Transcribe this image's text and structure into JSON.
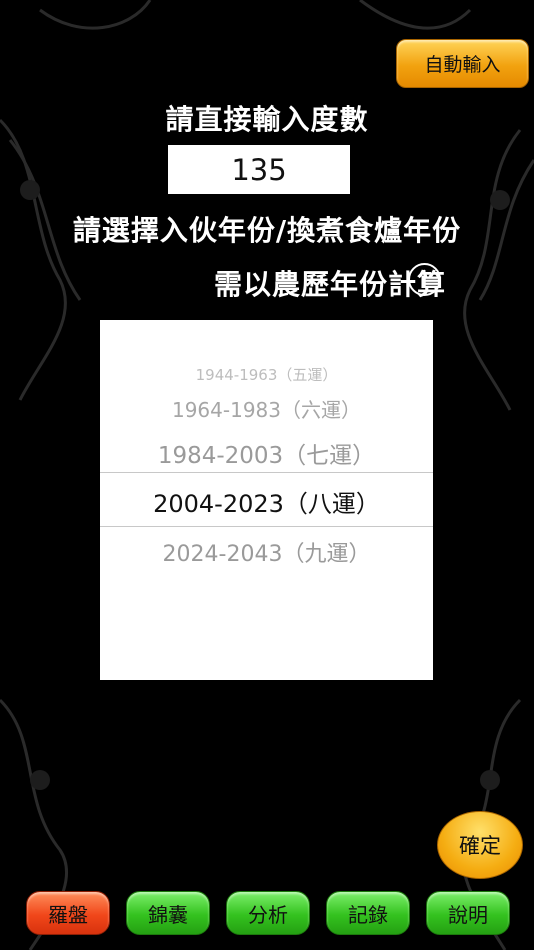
{
  "header": {
    "auto_input_label": "自動輸入"
  },
  "prompt": {
    "enter_degree_label": "請直接輸入度數",
    "degree_value": "135",
    "select_year_label": "請選擇入伙年份/換煮食爐年份",
    "lunar_note_label": "需以農歷年份計算",
    "info_icon_glyph": "i"
  },
  "picker": {
    "options": [
      "1944-1963（五運）",
      "1964-1983（六運）",
      "1984-2003（七運）",
      "2004-2023（八運）",
      "2024-2043（九運）"
    ],
    "selected_index": 3
  },
  "confirm_label": "確定",
  "tabbar": {
    "items": [
      {
        "label": "羅盤",
        "active": true
      },
      {
        "label": "錦囊",
        "active": false
      },
      {
        "label": "分析",
        "active": false
      },
      {
        "label": "記錄",
        "active": false
      },
      {
        "label": "說明",
        "active": false
      }
    ]
  },
  "colors": {
    "background": "#000000",
    "orange_button": "#f2a20f",
    "green_tab": "#34c21f",
    "red_tab": "#f1471a"
  }
}
